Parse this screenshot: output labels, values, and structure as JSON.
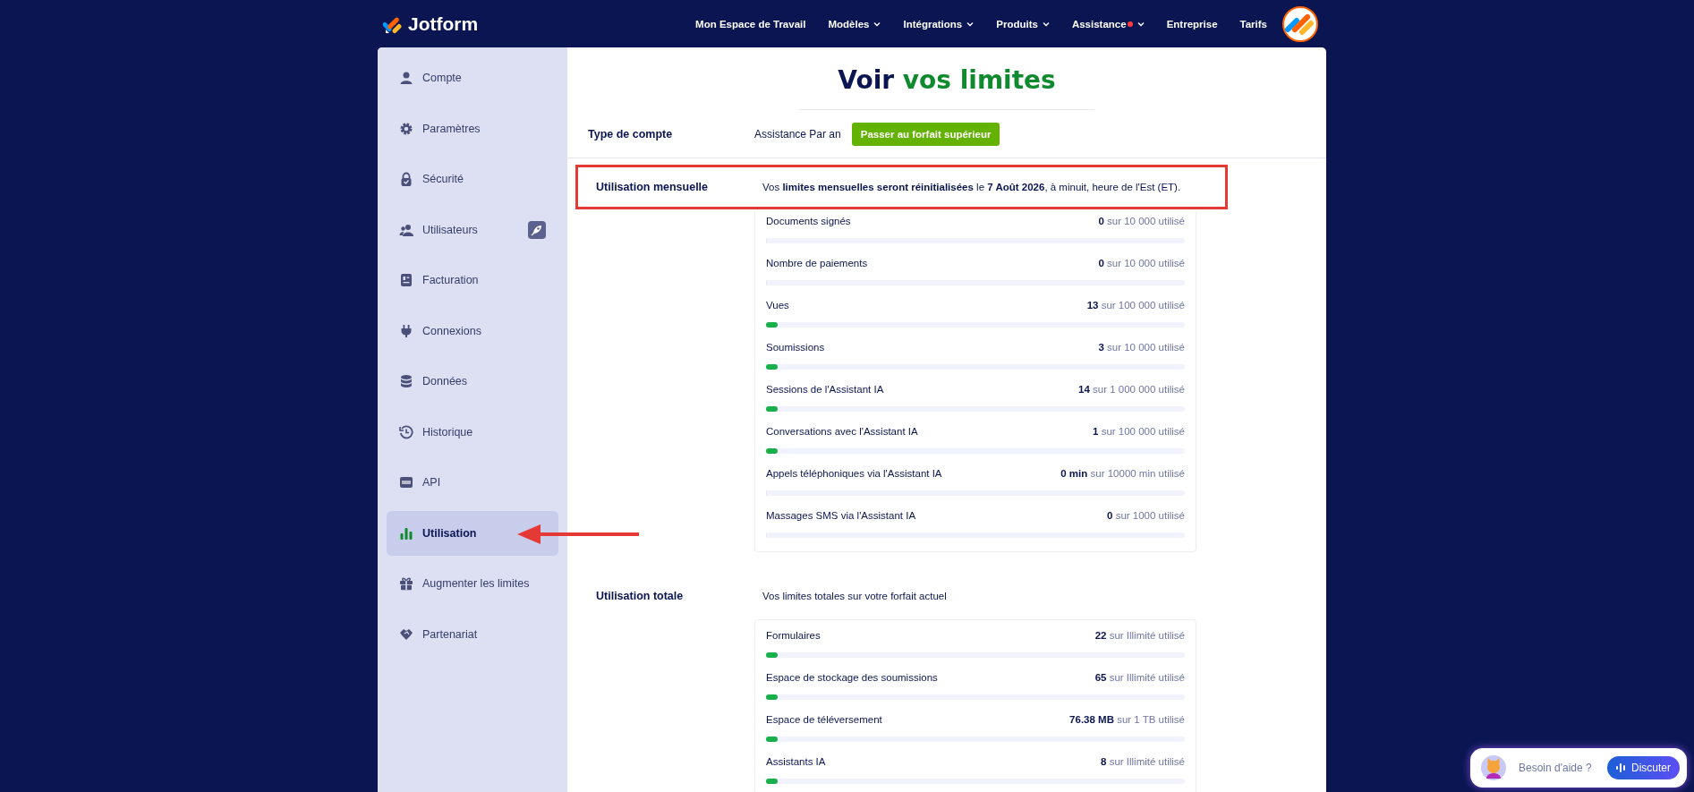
{
  "header": {
    "logo": "Jotform",
    "nav": [
      {
        "label": "Mon Espace de Travail",
        "has_menu": false,
        "notification": false
      },
      {
        "label": "Modèles",
        "has_menu": true,
        "notification": false
      },
      {
        "label": "Intégrations",
        "has_menu": true,
        "notification": false
      },
      {
        "label": "Produits",
        "has_menu": true,
        "notification": false
      },
      {
        "label": "Assistance",
        "has_menu": true,
        "notification": true
      },
      {
        "label": "Entreprise",
        "has_menu": false,
        "notification": false
      },
      {
        "label": "Tarifs",
        "has_menu": false,
        "notification": false
      }
    ]
  },
  "sidebar": {
    "items": [
      {
        "label": "Compte",
        "selected": false,
        "upgrade_badge": false,
        "annotated": false
      },
      {
        "label": "Paramètres",
        "selected": false,
        "upgrade_badge": false,
        "annotated": false
      },
      {
        "label": "Sécurité",
        "selected": false,
        "upgrade_badge": false,
        "annotated": false
      },
      {
        "label": "Utilisateurs",
        "selected": false,
        "upgrade_badge": true,
        "annotated": false
      },
      {
        "label": "Facturation",
        "selected": false,
        "upgrade_badge": false,
        "annotated": false
      },
      {
        "label": "Connexions",
        "selected": false,
        "upgrade_badge": false,
        "annotated": false
      },
      {
        "label": "Données",
        "selected": false,
        "upgrade_badge": false,
        "annotated": false
      },
      {
        "label": "Historique",
        "selected": false,
        "upgrade_badge": false,
        "annotated": false
      },
      {
        "label": "API",
        "selected": false,
        "upgrade_badge": false,
        "annotated": false
      },
      {
        "label": "Utilisation",
        "selected": true,
        "upgrade_badge": false,
        "annotated": true
      },
      {
        "label": "Augmenter les limites",
        "selected": false,
        "upgrade_badge": false,
        "annotated": false
      },
      {
        "label": "Partenariat",
        "selected": false,
        "upgrade_badge": false,
        "annotated": false
      }
    ]
  },
  "content": {
    "title": "Voir",
    "title_highlight": "vos limites",
    "account": {
      "label": "Type de compte",
      "plan": "Assistance Par an",
      "button": "Passer au forfait supérieur"
    },
    "sections": [
      {
        "label": "Utilisation mensuelle",
        "description": "Vos **limites mensuelles seront réinitialisées** le **7 Août 2026**, à minuit, heure de l'Est (ET).",
        "highlighted": true,
        "items": [
          {
            "label": "Documents signés",
            "value": "**0** sur 10 000 utilisé",
            "level": 0
          },
          {
            "label": "Nombre de paiements",
            "value": "**0** sur 10 000 utilisé",
            "level": 0
          },
          {
            "label": "Vues",
            "value": "**13** sur 100 000 utilisé",
            "level": 0.027
          },
          {
            "label": "Soumissions",
            "value": "**3** sur 10 000 utilisé",
            "level": 0.027
          },
          {
            "label": "Sessions de l'Assistant IA",
            "value": "**14** sur 1 000 000 utilisé",
            "level": 0.027
          },
          {
            "label": "Conversations avec l'Assistant IA",
            "value": "**1** sur 100 000 utilisé",
            "level": 0.027
          },
          {
            "label": "Appels téléphoniques via l'Assistant IA",
            "value": "**0 min** sur 10000 min utilisé",
            "level": 0
          },
          {
            "label": "Massages SMS via l'Assistant IA",
            "value": "**0** sur 1000 utilisé",
            "level": 0
          }
        ]
      },
      {
        "label": "Utilisation totale",
        "description": "Vos limites totales sur votre forfait actuel",
        "highlighted": false,
        "items": [
          {
            "label": "Formulaires",
            "value": "**22** sur Illimité utilisé",
            "level": 0.027
          },
          {
            "label": "Espace de stockage des soumissions",
            "value": "**65** sur Illimité utilisé",
            "level": 0.027
          },
          {
            "label": "Espace de téléversement",
            "value": "**76.38 MB** sur 1 TB utilisé",
            "level": 0.027
          },
          {
            "label": "Assistants IA",
            "value": "**8** sur Illimité utilisé",
            "level": 0.027
          }
        ]
      }
    ]
  },
  "help_widget": {
    "text": "Besoin d'aide ?",
    "button": "Discuter"
  }
}
